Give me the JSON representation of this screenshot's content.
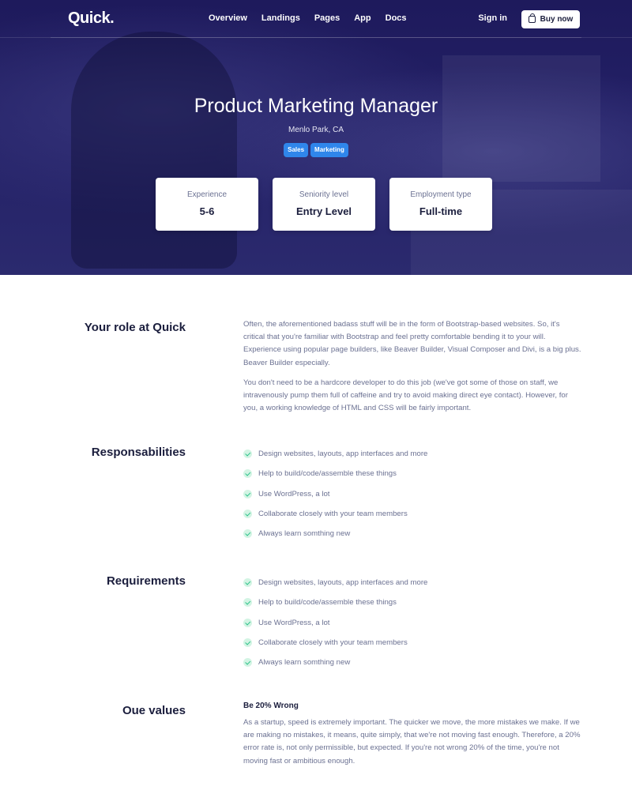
{
  "nav": {
    "logo": "Quick.",
    "links": [
      "Overview",
      "Landings",
      "Pages",
      "App",
      "Docs"
    ],
    "signin": "Sign in",
    "buy": "Buy now"
  },
  "hero": {
    "title": "Product Marketing Manager",
    "location": "Menlo Park, CA",
    "tags": [
      "Sales",
      "Marketing"
    ],
    "tag_color": "#2f86eb",
    "stats": [
      {
        "label": "Experience",
        "value": "5-6"
      },
      {
        "label": "Seniority level",
        "value": "Entry Level"
      },
      {
        "label": "Employment type",
        "value": "Full-time"
      }
    ]
  },
  "role": {
    "heading": "Your role at Quick",
    "paragraphs": [
      "Often, the aforementioned badass stuff will be in the form of Bootstrap-based websites. So, it's critical that you're familiar with Bootstrap and feel pretty comfortable bending it to your will. Experience using popular page builders, like Beaver Builder, Visual Composer and Divi, is a big plus. Beaver Builder especially.",
      "You don't need to be a hardcore developer to do this job (we've got some of those on staff, we intravenously pump them full of caffeine and try to avoid making direct eye contact). However, for you, a working knowledge of HTML and CSS will be fairly important."
    ]
  },
  "responsibilities": {
    "heading": "Responsabilities",
    "items": [
      "Design websites, layouts, app interfaces and more",
      "Help to build/code/assemble these things",
      "Use WordPress, a lot",
      "Collaborate closely with your team members",
      "Always learn somthing new"
    ]
  },
  "requirements": {
    "heading": "Requirements",
    "items": [
      "Design websites, layouts, app interfaces and more",
      "Help to build/code/assemble these things",
      "Use WordPress, a lot",
      "Collaborate closely with your team members",
      "Always learn somthing new"
    ]
  },
  "values": {
    "heading": "Oue values",
    "title": "Be 20% Wrong",
    "text": "As a startup, speed is extremely important. The quicker we move, the more mistakes we make. If we are making no mistakes, it means, quite simply, that we're not moving fast enough. Therefore, a 20% error rate is, not only permissible, but expected. If you're not wrong 20% of the time, you're not moving fast or ambitious enough."
  },
  "colors": {
    "hero_bg": "#231f63",
    "check_bg": "#d3f4e4",
    "check_mark": "#2cc38a",
    "body_text": "#6b7192",
    "heading_text": "#1b1e3d"
  }
}
